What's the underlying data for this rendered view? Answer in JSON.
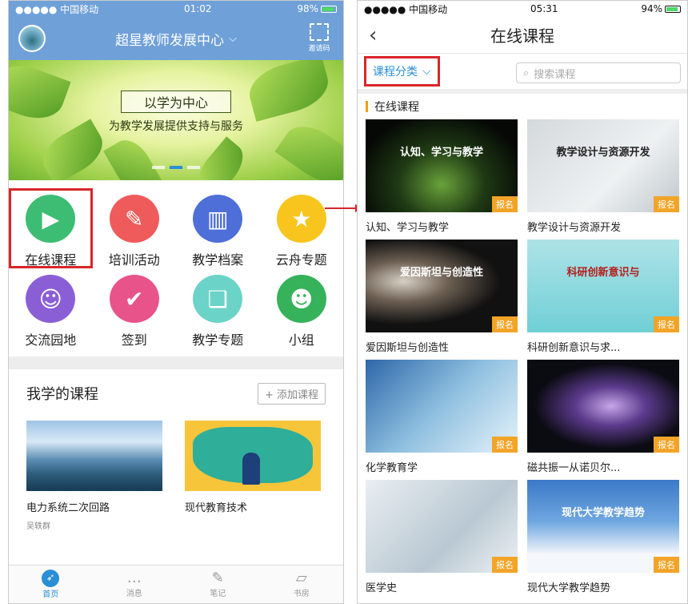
{
  "left": {
    "status": {
      "carrier": "●●●●● 中国移动 ",
      "time": "01:02",
      "battery": "98%"
    },
    "header": {
      "title": "超星教师发展中心",
      "invite_label": "邀请码"
    },
    "banner": {
      "line1": "以学为中心",
      "line2": "为教学发展提供支持与服务"
    },
    "grid": [
      {
        "label": "在线课程",
        "icon": "play-icon",
        "color": "#3dbd73",
        "glyph": "▶"
      },
      {
        "label": "培训活动",
        "icon": "book-reader-icon",
        "color": "#ef5b5b",
        "glyph": "✎"
      },
      {
        "label": "教学档案",
        "icon": "binders-icon",
        "color": "#4f6fd8",
        "glyph": "▥"
      },
      {
        "label": "云舟专题",
        "icon": "trophy-icon",
        "color": "#f7c51e",
        "glyph": "★"
      },
      {
        "label": "交流园地",
        "icon": "people-icon",
        "color": "#8a5fd6",
        "glyph": "☺"
      },
      {
        "label": "签到",
        "icon": "signin-icon",
        "color": "#e8548a",
        "glyph": "✔"
      },
      {
        "label": "教学专题",
        "icon": "open-book-icon",
        "color": "#6bd3c8",
        "glyph": "❑"
      },
      {
        "label": "小组",
        "icon": "group-icon",
        "color": "#36b25a",
        "glyph": "☻"
      }
    ],
    "my_courses": {
      "title": "我学的课程",
      "add_label": "+ 添加课程",
      "items": [
        {
          "title": "电力系统二次回路",
          "sub": "吴轶群"
        },
        {
          "title": "现代教育技术",
          "sub": ""
        }
      ]
    },
    "tabs": [
      {
        "label": "首页",
        "icon": "compass-icon",
        "glyph": "➶"
      },
      {
        "label": "消息",
        "icon": "message-icon",
        "glyph": "…"
      },
      {
        "label": "笔记",
        "icon": "note-icon",
        "glyph": "✎"
      },
      {
        "label": "书房",
        "icon": "bookshelf-icon",
        "glyph": "▱"
      }
    ]
  },
  "right": {
    "status": {
      "carrier": "●●●●● 中国移动 ",
      "time": "05:31",
      "battery": "94%"
    },
    "header": {
      "back": "‹",
      "title": "在线课程"
    },
    "filter": {
      "category_label": "课程分类",
      "search_placeholder": "搜索课程"
    },
    "section": "在线课程",
    "badge": "报名",
    "courses": [
      {
        "title": "认知、学习与教学",
        "img_text": "认知、学习与教学"
      },
      {
        "title": "教学设计与资源开发",
        "img_text": "教学设计与资源开发"
      },
      {
        "title": "爱因斯坦与创造性",
        "img_text": "爱因斯坦与创造性"
      },
      {
        "title": "科研创新意识与求...",
        "img_text": "科研创新意识与"
      },
      {
        "title": "化学教育学",
        "img_text": ""
      },
      {
        "title": "磁共振一从诺贝尔...",
        "img_text": ""
      },
      {
        "title": "医学史",
        "img_text": ""
      },
      {
        "title": "现代大学教学趋势",
        "img_text": "现代大学教学趋势"
      }
    ]
  }
}
